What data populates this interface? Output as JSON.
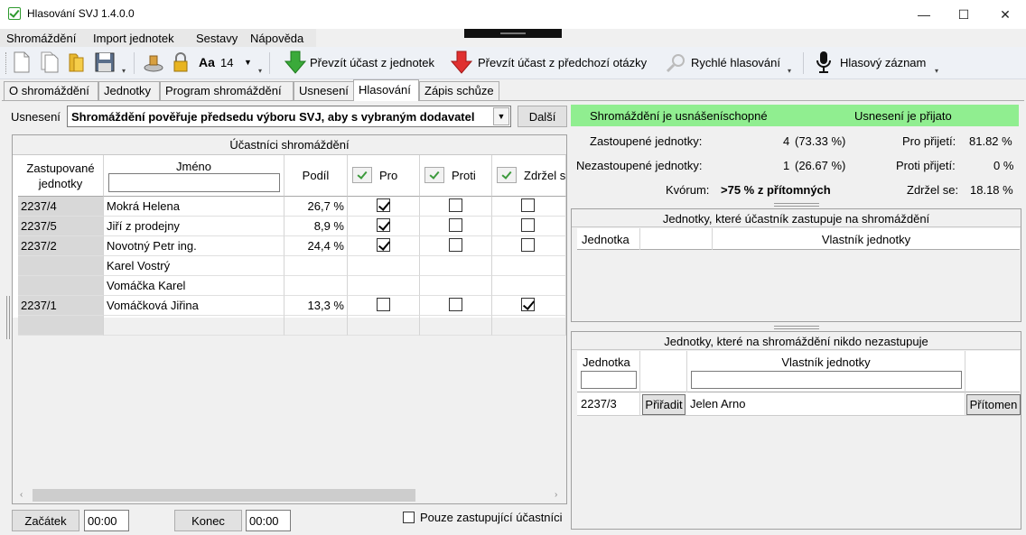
{
  "window": {
    "title": "Hlasování SVJ 1.4.0.0",
    "minimize": "—",
    "maximize": "☐",
    "close": "✕"
  },
  "menu": [
    "Shromáždění",
    "Import jednotek",
    "Sestavy",
    "Nápověda"
  ],
  "toolbar": {
    "font_label": "Aa",
    "font_size": "14",
    "take_units": "Převzít účast z jednotek",
    "take_previous": "Převzít účast z předchozí otázky",
    "quick_vote": "Rychlé hlasování",
    "voice_record": "Hlasový záznam"
  },
  "tabs": [
    "O shromáždění",
    "Jednotky",
    "Program shromáždění",
    "Usnesení",
    "Hlasování",
    "Zápis schůze"
  ],
  "active_tab": "Hlasování",
  "resolution": {
    "label": "Usnesení",
    "value": "Shromáždění pověřuje předsedu výboru SVJ, aby s vybraným dodavatel",
    "next_button": "Další"
  },
  "participants": {
    "title": "Účastníci shromáždění",
    "headers": {
      "unit_line1": "Zastupované",
      "unit_line2": "jednotky",
      "name": "Jméno",
      "share": "Podíl",
      "for": "Pro",
      "against": "Proti",
      "abstain": "Zdržel s"
    },
    "rows": [
      {
        "unit": "2237/4",
        "name": "Mokrá Helena",
        "share": "26,7 %",
        "for": true,
        "against": false,
        "abstain": false,
        "has_checks": true
      },
      {
        "unit": "2237/5",
        "name": "Jiří z prodejny",
        "share": "8,9 %",
        "for": true,
        "against": false,
        "abstain": false,
        "has_checks": true
      },
      {
        "unit": "2237/2",
        "name": "Novotný Petr ing.",
        "share": "24,4 %",
        "for": true,
        "against": false,
        "abstain": false,
        "has_checks": true
      },
      {
        "unit": "",
        "name": "Karel Vostrý",
        "share": "",
        "for": false,
        "against": false,
        "abstain": false,
        "has_checks": false
      },
      {
        "unit": "",
        "name": "Vomáčka Karel",
        "share": "",
        "for": false,
        "against": false,
        "abstain": false,
        "has_checks": false
      },
      {
        "unit": "2237/1",
        "name": "Vomáčková Jiřina",
        "share": "13,3 %",
        "for": false,
        "against": false,
        "abstain": true,
        "has_checks": true
      },
      {
        "unit": "",
        "name": "",
        "share": "",
        "for": false,
        "against": false,
        "abstain": false,
        "has_checks": false
      }
    ]
  },
  "bottom": {
    "start_button": "Začátek",
    "start_time": "00:00",
    "end_button": "Konec",
    "end_time": "00:00",
    "only_representing": "Pouze zastupující účastníci"
  },
  "status": {
    "quorate": "Shromáždění je usnášeníschopné",
    "resolution_result": "Usnesení je přijato",
    "represented_label": "Zastoupené jednotky:",
    "represented_count": "4",
    "represented_pct": "(73.33 %)",
    "unrepresented_label": "Nezastoupené jednotky:",
    "unrepresented_count": "1",
    "unrepresented_pct": "(26.67 %)",
    "quorum_label": "Kvórum:",
    "quorum_value": ">75 % z přítomných",
    "for_label": "Pro přijetí:",
    "for_value": "81.82 %",
    "against_label": "Proti přijetí:",
    "against_value": "0 %",
    "abstain_label": "Zdržel se:",
    "abstain_value": "18.18 %"
  },
  "represented_units": {
    "title": "Jednotky, které účastník zastupuje na shromáždění",
    "col_unit": "Jednotka",
    "col_owner": "Vlastník jednotky"
  },
  "unrepresented_units": {
    "title": "Jednotky, které na shromáždění nikdo nezastupuje",
    "col_unit": "Jednotka",
    "col_owner": "Vlastník jednotky",
    "rows": [
      {
        "unit": "2237/3",
        "assign": "Přiřadit",
        "owner": "Jelen Arno",
        "present": "Přítomen"
      }
    ]
  }
}
